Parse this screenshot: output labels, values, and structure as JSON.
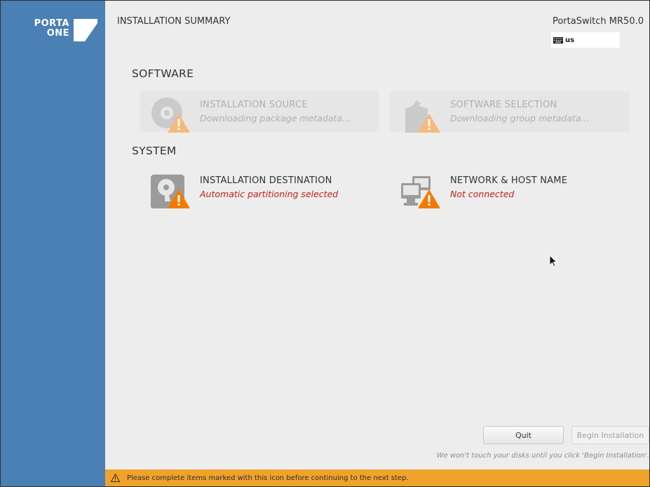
{
  "sidebar": {
    "logo_top": "PORTA",
    "logo_bottom": "ONE"
  },
  "header": {
    "title": "INSTALLATION SUMMARY",
    "product": "PortaSwitch MR50.0",
    "keyboard_layout": "us"
  },
  "sections": {
    "software": {
      "label": "SOFTWARE",
      "spokes": [
        {
          "title": "INSTALLATION SOURCE",
          "status": "Downloading package metadata...",
          "icon": "disc-icon",
          "state": "disabled"
        },
        {
          "title": "SOFTWARE SELECTION",
          "status": "Downloading group metadata...",
          "icon": "package-icon",
          "state": "disabled"
        }
      ]
    },
    "system": {
      "label": "SYSTEM",
      "spokes": [
        {
          "title": "INSTALLATION DESTINATION",
          "status": "Automatic partitioning selected",
          "icon": "hard-drive-icon",
          "state": "warning"
        },
        {
          "title": "NETWORK & HOST NAME",
          "status": "Not connected",
          "icon": "network-icon",
          "state": "warning"
        }
      ]
    }
  },
  "footer": {
    "quit_label": "Quit",
    "begin_label": "Begin Installation",
    "hint": "We won't touch your disks until you click 'Begin Installation'.",
    "warning": "Please complete items marked with this icon before continuing to the next step."
  },
  "colors": {
    "sidebar": "#4a80b4",
    "warning_bar": "#f0a32a",
    "warning_badge": "#f57900",
    "error_text": "#c4201b"
  }
}
